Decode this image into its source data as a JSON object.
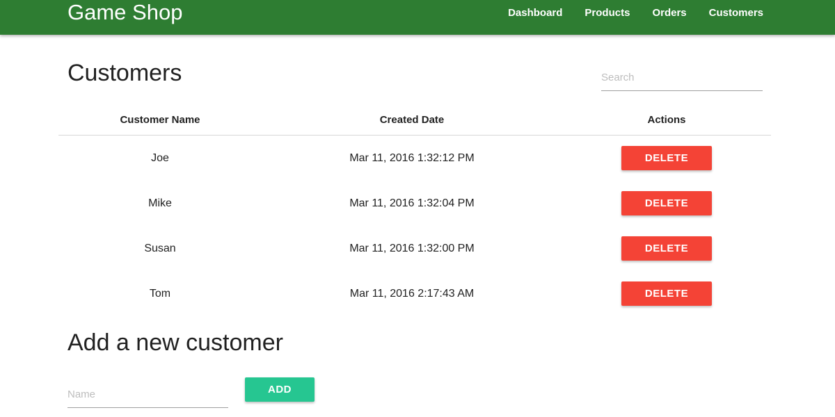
{
  "navbar": {
    "brand": "Game Shop",
    "links": [
      "Dashboard",
      "Products",
      "Orders",
      "Customers"
    ],
    "color": "#2e7d32"
  },
  "customers": {
    "title": "Customers",
    "search_placeholder": "Search",
    "columns": [
      "Customer Name",
      "Created Date",
      "Actions"
    ],
    "rows": [
      {
        "name": "Joe",
        "created": "Mar 11, 2016 1:32:12 PM",
        "action": "DELETE"
      },
      {
        "name": "Mike",
        "created": "Mar 11, 2016 1:32:04 PM",
        "action": "DELETE"
      },
      {
        "name": "Susan",
        "created": "Mar 11, 2016 1:32:00 PM",
        "action": "DELETE"
      },
      {
        "name": "Tom",
        "created": "Mar 11, 2016 2:17:43 AM",
        "action": "DELETE"
      }
    ],
    "delete_color": "#f44336"
  },
  "add_customer": {
    "title": "Add a new customer",
    "name_placeholder": "Name",
    "add_label": "ADD",
    "add_color": "#26c691"
  }
}
